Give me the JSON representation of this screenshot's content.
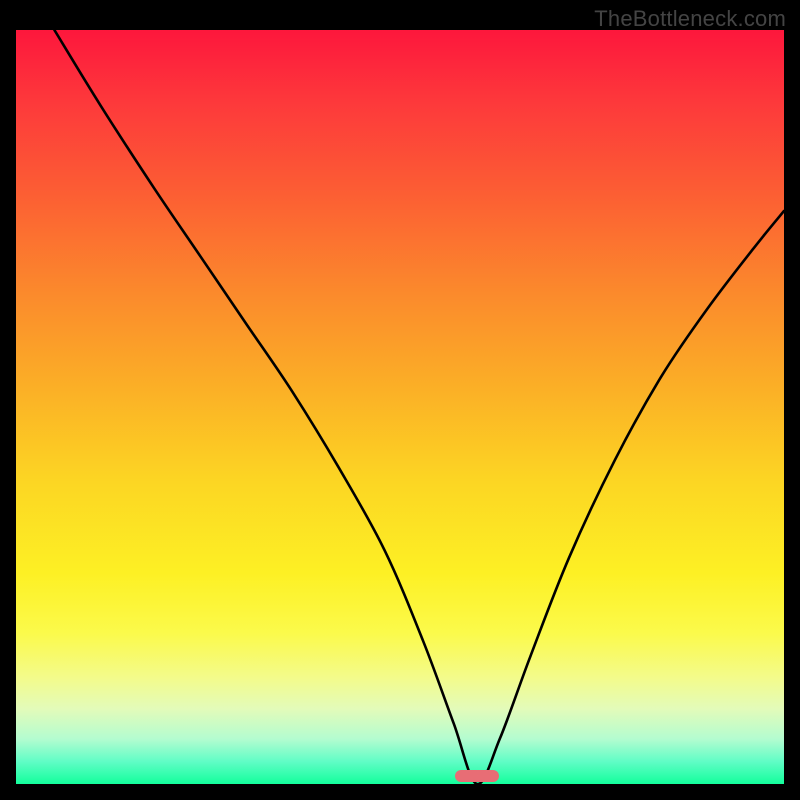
{
  "watermark": "TheBottleneck.com",
  "chart_data": {
    "type": "line",
    "title": "",
    "xlabel": "",
    "ylabel": "",
    "xlim": [
      0,
      100
    ],
    "ylim": [
      0,
      100
    ],
    "grid": false,
    "legend": false,
    "marker": {
      "x": 60,
      "color": "#e86d75"
    },
    "series": [
      {
        "name": "bottleneck-curve",
        "color": "#000000",
        "x": [
          5,
          11,
          18,
          24,
          30,
          36,
          42,
          48,
          53,
          57,
          60,
          63,
          67,
          72,
          78,
          84,
          90,
          96,
          100
        ],
        "y": [
          100,
          90,
          79,
          70,
          61,
          52,
          42,
          31,
          19,
          8,
          0,
          6,
          17,
          30,
          43,
          54,
          63,
          71,
          76
        ]
      }
    ],
    "gradient_stops": [
      {
        "pos": 0,
        "color": "#fd173c"
      },
      {
        "pos": 10,
        "color": "#fd3a3b"
      },
      {
        "pos": 22,
        "color": "#fc5f33"
      },
      {
        "pos": 35,
        "color": "#fb8a2c"
      },
      {
        "pos": 48,
        "color": "#fbb126"
      },
      {
        "pos": 60,
        "color": "#fcd623"
      },
      {
        "pos": 72,
        "color": "#fdf024"
      },
      {
        "pos": 80,
        "color": "#fbfa4b"
      },
      {
        "pos": 86,
        "color": "#f3fb8c"
      },
      {
        "pos": 90,
        "color": "#e3fbb9"
      },
      {
        "pos": 94,
        "color": "#b4fcd0"
      },
      {
        "pos": 97,
        "color": "#61fdc6"
      },
      {
        "pos": 100,
        "color": "#13fe9c"
      }
    ]
  }
}
